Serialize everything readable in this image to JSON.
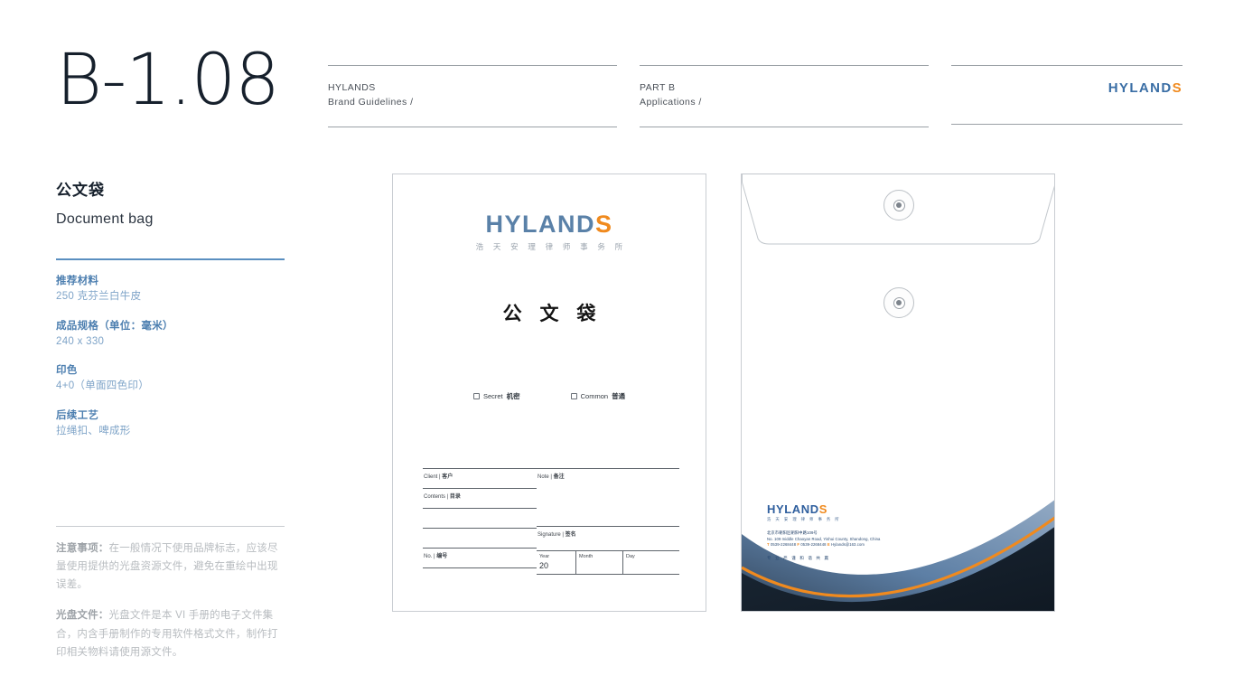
{
  "page": {
    "number": "B-1.08",
    "title_cn": "公文袋",
    "title_en": "Document bag"
  },
  "brand": {
    "name": "HYLANDS",
    "name_main": "HYLAND",
    "name_accent": "S",
    "name_cn": "浩 天 安 理 律 师 事 务 所",
    "color_blue": "#3a6ea5",
    "color_orange": "#f08a1e",
    "color_navy": "#16202c"
  },
  "header": {
    "col1": {
      "line1": "HYLANDS",
      "line2": "Brand Guidelines /"
    },
    "col2": {
      "line1": "PART B",
      "line2": "Applications /"
    }
  },
  "specs": [
    {
      "label": "推荐材料",
      "value": "250 克芬兰白牛皮"
    },
    {
      "label": "成品规格（单位：毫米）",
      "value": "240 x 330"
    },
    {
      "label": "印色",
      "value": "4+0（单面四色印）"
    },
    {
      "label": "后续工艺",
      "value": "拉绳扣、啤成形"
    }
  ],
  "notes": [
    {
      "label": "注意事项：",
      "text": "在一般情况下使用品牌标志，应该尽量使用提供的光盘资源文件，避免在重绘中出现误差。"
    },
    {
      "label": "光盘文件：",
      "text": "光盘文件是本 VI 手册的电子文件集合，内含手册制作的专用软件格式文件，制作打印相关物料请使用源文件。"
    }
  ],
  "bag_front": {
    "title": "公 文 袋",
    "checkboxes": [
      {
        "en": "Secret",
        "cn": "机密"
      },
      {
        "en": "Common",
        "cn": "普通"
      }
    ],
    "form_left": [
      {
        "en": "Client | ",
        "cn": "客户"
      },
      {
        "en": "Contents | ",
        "cn": "目录"
      },
      {
        "en": "",
        "cn": ""
      },
      {
        "en": "",
        "cn": ""
      },
      {
        "en": "No. | ",
        "cn": "编号"
      }
    ],
    "form_right": {
      "note": {
        "en": "Note | ",
        "cn": "备注"
      },
      "signature": {
        "en": "Signature | ",
        "cn": "签名"
      },
      "date": {
        "year_label": "Year",
        "year_value": "20",
        "month_label": "Month",
        "day_label": "Day"
      }
    }
  },
  "bag_back": {
    "address_cn": "北京市朝阳区朝阳中路109号",
    "address_en": "No. 109 middle Chaoyan Road, Yishui County, Shandong, China",
    "contact": {
      "tel_key": "T",
      "tel": "0539-2268448",
      "fax_key": "F",
      "fax": "0539-2268448",
      "email_key": "E",
      "email": "Hylands@163.com"
    },
    "tagline": "专 业 严 谨    和 谐 共 赢",
    "wave_colors": {
      "navy": "#16202c",
      "steel": "#5c7ea3",
      "orange": "#f08a1e"
    }
  }
}
